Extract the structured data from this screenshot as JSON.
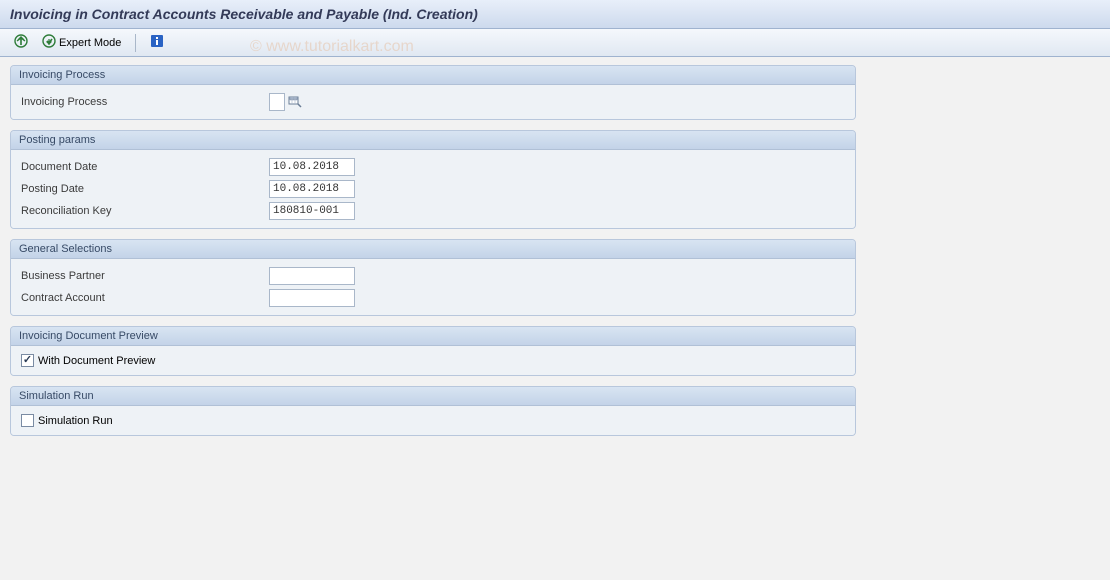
{
  "title": "Invoicing in Contract Accounts Receivable and Payable (Ind. Creation)",
  "toolbar": {
    "expert_mode_label": "Expert Mode"
  },
  "watermark": "© www.tutorialkart.com",
  "groups": {
    "invoicing_process": {
      "header": "Invoicing Process",
      "label": "Invoicing Process",
      "value": ""
    },
    "posting_params": {
      "header": "Posting params",
      "document_date_label": "Document Date",
      "document_date_value": "10.08.2018",
      "posting_date_label": "Posting Date",
      "posting_date_value": "10.08.2018",
      "reconciliation_key_label": "Reconciliation Key",
      "reconciliation_key_value": "180810-001"
    },
    "general_selections": {
      "header": "General Selections",
      "business_partner_label": "Business Partner",
      "business_partner_value": "",
      "contract_account_label": "Contract Account",
      "contract_account_value": ""
    },
    "preview": {
      "header": "Invoicing Document Preview",
      "checkbox_label": "With Document Preview",
      "checked": true
    },
    "simulation": {
      "header": "Simulation Run",
      "checkbox_label": "Simulation Run",
      "checked": false
    }
  }
}
